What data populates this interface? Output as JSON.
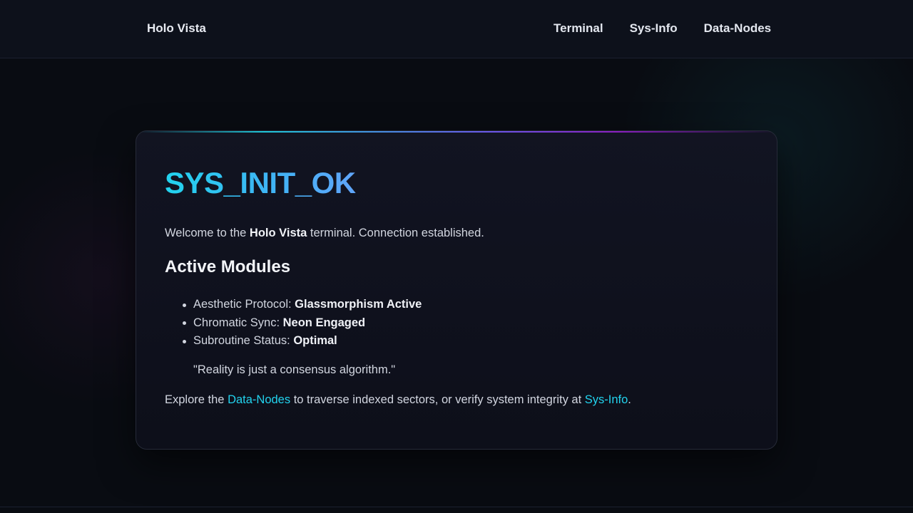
{
  "header": {
    "brand": "Holo Vista",
    "nav": [
      {
        "label": "Terminal"
      },
      {
        "label": "Sys-Info"
      },
      {
        "label": "Data-Nodes"
      }
    ]
  },
  "card": {
    "title": "SYS_INIT_OK",
    "welcome": {
      "prefix": "Welcome to the ",
      "bold": "Holo Vista",
      "suffix": " terminal. Connection established."
    },
    "modules_heading": "Active Modules",
    "modules": [
      {
        "label": "Aesthetic Protocol: ",
        "value": "Glassmorphism Active"
      },
      {
        "label": "Chromatic Sync: ",
        "value": "Neon Engaged"
      },
      {
        "label": "Subroutine Status: ",
        "value": "Optimal"
      }
    ],
    "quote": "\"Reality is just a consensus algorithm.\"",
    "explore": {
      "prefix": "Explore the ",
      "link1": "Data-Nodes",
      "middle": " to traverse indexed sectors, or verify system integrity at ",
      "link2": "Sys-Info",
      "suffix": "."
    }
  },
  "colors": {
    "accent_cyan": "#22d3ee",
    "accent_blue": "#60a5fa",
    "accent_purple": "#8a1fc0",
    "background": "#090c12"
  }
}
